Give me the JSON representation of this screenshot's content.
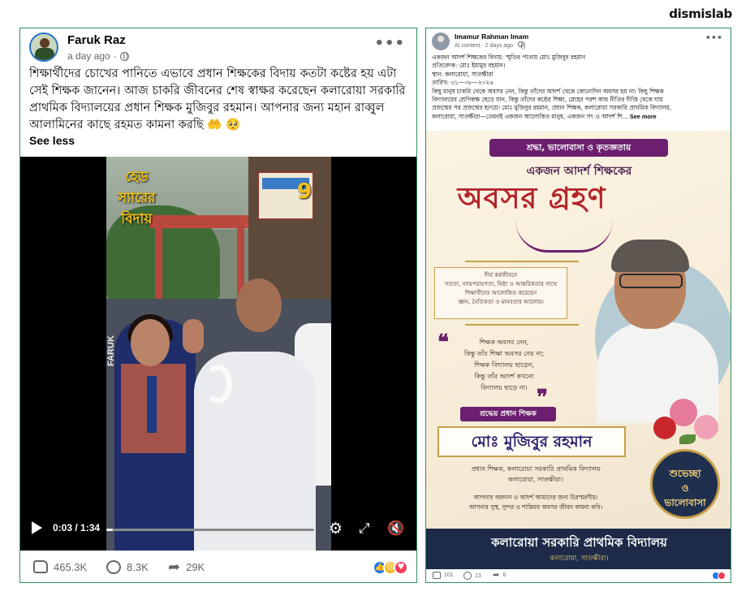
{
  "brand": "dismislab",
  "left_post": {
    "author": "Faruk Raz",
    "time": "a day ago",
    "more_icon": "more-horizontal-icon",
    "text": "শিক্ষার্থীদের চোখের পানিতে এভাবে প্রধান শিক্ষকের বিদায় কতটা কষ্টের হয় এটা সেই শিক্ষক জানেন। আজ চাকরি জীবনের শেষ স্বাক্ষর করেছেন কলারোয়া সরকারি প্রাথমিক বিদ্যালয়ের প্রধান শিক্ষক মুজিবুর রহমান। আপনার জন্য মহান রাব্বুল আলামিনের কাছে রহমত কামনা করছি 🤲 🥺",
    "see_less": "See less",
    "video": {
      "overlay_text": "হেড\nস্যারের\nবিদায়",
      "watermark": "FARUK",
      "time": "0:03 / 1:34",
      "progress": 0.032
    },
    "actions": {
      "likes": "465.3K",
      "comments": "8.3K",
      "shares": "29K"
    },
    "reaction_colors": [
      "#1877f2",
      "#f7b928",
      "#f33e58"
    ]
  },
  "right_post": {
    "author": "Imamur Rahman Imam",
    "meta": "AI content · 2 days ago · ",
    "more_icon": "more-horizontal-icon",
    "text_lines": [
      "একজন আদর্শ শিক্ষকের বিদায়: স্মৃতির পাতায় মোঃ মুজিবুর রহমান",
      "প্রতিবেদক: মোঃ ইমামুর রহমান।",
      "স্থান: কলারোয়া, সাতক্ষীরা",
      "তারিখ: ৩১—০৮—২০২৬",
      "কিছু মানুষ চাকরি থেকে অবসর নেন, কিন্তু তাঁদের আদর্শ থেকে কোনোদিন অবসর হয় না। কিছু শিক্ষক",
      "বিদ্যালয়ের শ্রেণিকক্ষ ছেড়ে যান, কিন্তু তাঁদের কণ্ঠের শিক্ষা, স্নেহের পরশ আর নীতির দীপ্তি থেকে যায়",
      "প্রজন্মের পর প্রজন্মের হৃদয়ে। মোঃ মুজিবুর রহমান, প্রধান শিক্ষক, কলারোয়া সরকারি প্রাথমিক বিদ্যালয়,"
    ],
    "last_line": "কলারোয়া, সাতক্ষীরা—তেমনই একজন আলোকিত মানুষ, একজন সৎ ও আদর্শ শি... ",
    "see_more": "See more",
    "poster": {
      "banner": "শ্রদ্ধা, ভালোবাসা ও কৃতজ্ঞতায়",
      "subtitle": "একজন আদর্শ শিক্ষকের",
      "title": "অবসর গ্রহণ",
      "box_lines": [
        "দীর্ঘ কর্মজীবনে",
        "সততা, ন্যায়পরায়ণতা, নিষ্ঠা ও আন্তরিকতার সাথে",
        "শিক্ষার্থীদের আলোকিত করেছেন",
        "জ্ঞান, নৈতিকতা ও মানবতার আলোয়।"
      ],
      "quote_lines": [
        "শিক্ষক অবসর নেন,",
        "কিন্তু তাঁর শিক্ষা অবসর নেয় না;",
        "শিক্ষক বিদ্যালয় ছাড়েন,",
        "কিন্তু তাঁর আদর্শ কখনো",
        "বিদ্যালয় ছাড়ে না।"
      ],
      "role": "শ্রদ্ধেয় প্রধান শিক্ষক",
      "name": "মোঃ মুজিবুর রহমান",
      "designation_lines": [
        "প্রধান শিক্ষক, কলারোয়া সরকারি প্রাথমিক বিদ্যালয়",
        "কলারোয়া, সাতক্ষীরা।"
      ],
      "wish_lines": [
        "আপনার অবদান ও আদর্শ আমাদের জন্য চিরস্মরণীয়।",
        "আপনার সুস্থ, সুন্দর ও শান্তিময় অবসর জীবন কামনা করি।"
      ],
      "badge": "শুভেচ্ছা\nও\nভালোবাসা",
      "school": "কলারোয়া সরকারি প্রাথমিক বিদ্যালয়",
      "location": "কলারোয়া, সাতক্ষীরা।"
    },
    "actions": {
      "likes": "101",
      "comments": "13",
      "shares": "6"
    }
  }
}
